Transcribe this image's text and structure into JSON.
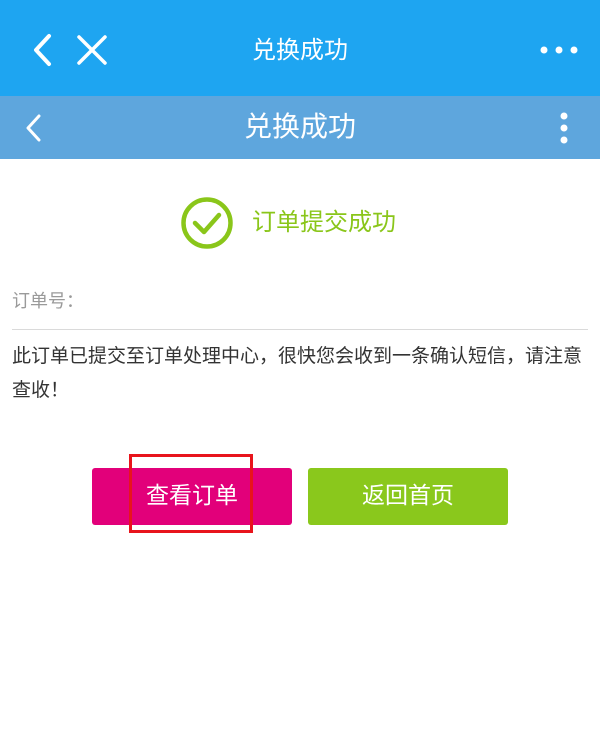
{
  "outer_bar": {
    "title": "兑换成功",
    "back_icon": "chevron-left-icon",
    "close_icon": "close-icon",
    "more_icon": "more-horizontal-icon",
    "background": "#1ea5f1"
  },
  "inner_bar": {
    "title": "兑换成功",
    "back_icon": "chevron-left-icon",
    "more_icon": "more-vertical-icon",
    "background": "#5ea6dd"
  },
  "status": {
    "icon": "check-circle-icon",
    "text": "订单提交成功",
    "color": "#8ac61a"
  },
  "order": {
    "number_label": "订单号：",
    "message": "此订单已提交至订单处理中心，很快您会收到一条确认短信，请注意查收！"
  },
  "actions": {
    "view_order_label": "查看订单",
    "view_order_color": "#e2007a",
    "home_label": "返回首页",
    "home_color": "#8ac81c"
  },
  "annotation": {
    "highlight_color": "#e8141c"
  }
}
